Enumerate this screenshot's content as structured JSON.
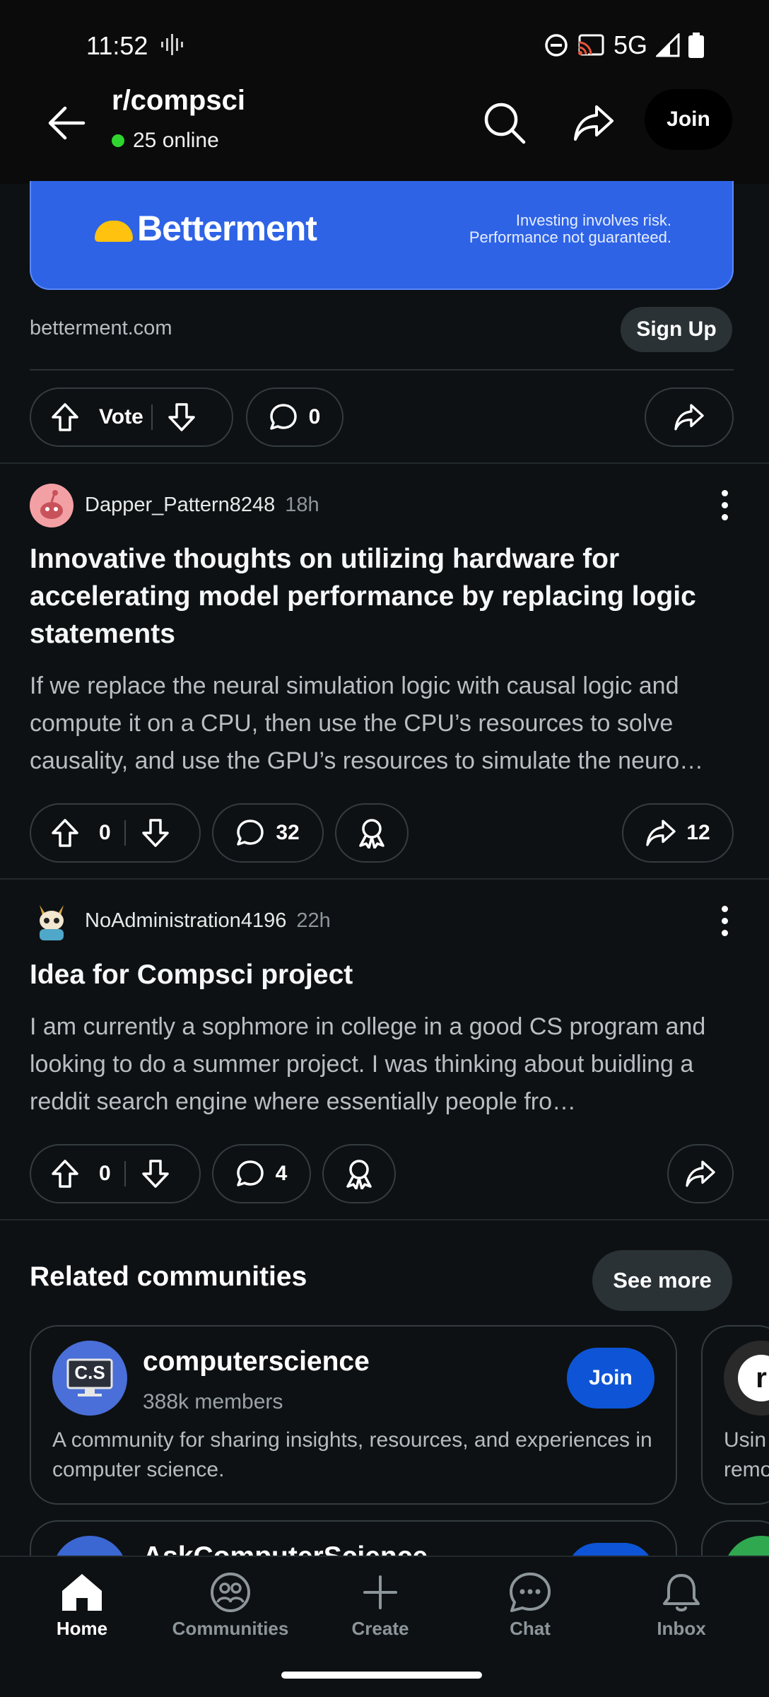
{
  "status_bar": {
    "time": "11:52",
    "network": "5G"
  },
  "header": {
    "subreddit": "r/compsci",
    "online": "25 online",
    "join_label": "Join"
  },
  "ad": {
    "brand": "Betterment",
    "disclaimer_line1": "Investing involves risk.",
    "disclaimer_line2": "Performance not guaranteed.",
    "domain": "betterment.com",
    "cta": "Sign Up",
    "vote_label": "Vote",
    "comments": "0"
  },
  "posts": [
    {
      "author": "Dapper_Pattern8248",
      "age": "18h",
      "title": "Innovative thoughts on utilizing hardware for accelerating model performance by replacing logic statements",
      "body": "If we replace the neural simulation logic with causal logic and compute it on a CPU, then use the CPU’s resources to solve causality, and use the GPU’s resources to simulate the neuro…",
      "votes": "0",
      "comments": "32",
      "shares": "12"
    },
    {
      "author": "NoAdministration4196",
      "age": "22h",
      "title": "Idea for Compsci project",
      "body": "I am currently a sophmore in college in a good CS program and looking to do a summer project. I was thinking about buidling a reddit search engine where essentially people fro…",
      "votes": "0",
      "comments": "4"
    }
  ],
  "related": {
    "title": "Related communities",
    "see_more": "See more",
    "communities": [
      {
        "icon_text": "C.S",
        "name": "computerscience",
        "members": "388k members",
        "join_label": "Join",
        "description": "A community for sharing insights, resources, and experiences in computer science."
      },
      {
        "name": "AskComputerScience"
      }
    ],
    "peek_text_line1": "Usin",
    "peek_text_line2": "remo"
  },
  "bottom_nav": [
    {
      "label": "Home",
      "icon": "home-icon",
      "active": true
    },
    {
      "label": "Communities",
      "icon": "communities-icon"
    },
    {
      "label": "Create",
      "icon": "plus-icon"
    },
    {
      "label": "Chat",
      "icon": "chat-icon"
    },
    {
      "label": "Inbox",
      "icon": "bell-icon"
    }
  ],
  "colors": {
    "background": "#0e1113",
    "ad_blue": "#2e63e6",
    "join_blue": "#0d55d6",
    "online_green": "#2fd52f"
  }
}
